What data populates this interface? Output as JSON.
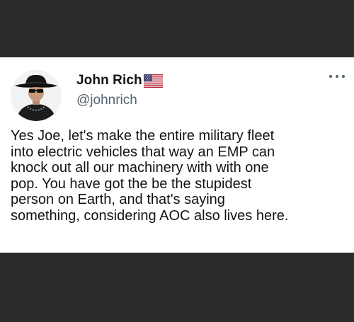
{
  "tweet": {
    "author": {
      "display_name": "John Rich",
      "handle": "@johnrich",
      "verified_flag_icon": "us-flag-icon",
      "avatar_icon": "cowboy-hat-avatar"
    },
    "more_icon": "more-horizontal-icon",
    "text": "Yes Joe, let's make the entire military fleet\ninto electric vehicles that way an EMP can\nknock out all our machinery with with one\npop. You have got the be the stupidest\nperson on Earth, and that's saying\nsomething, considering AOC also lives here."
  },
  "colors": {
    "background": "#2b2b2b",
    "card": "#ffffff",
    "text": "#0f1419",
    "secondary_text": "#536471"
  }
}
